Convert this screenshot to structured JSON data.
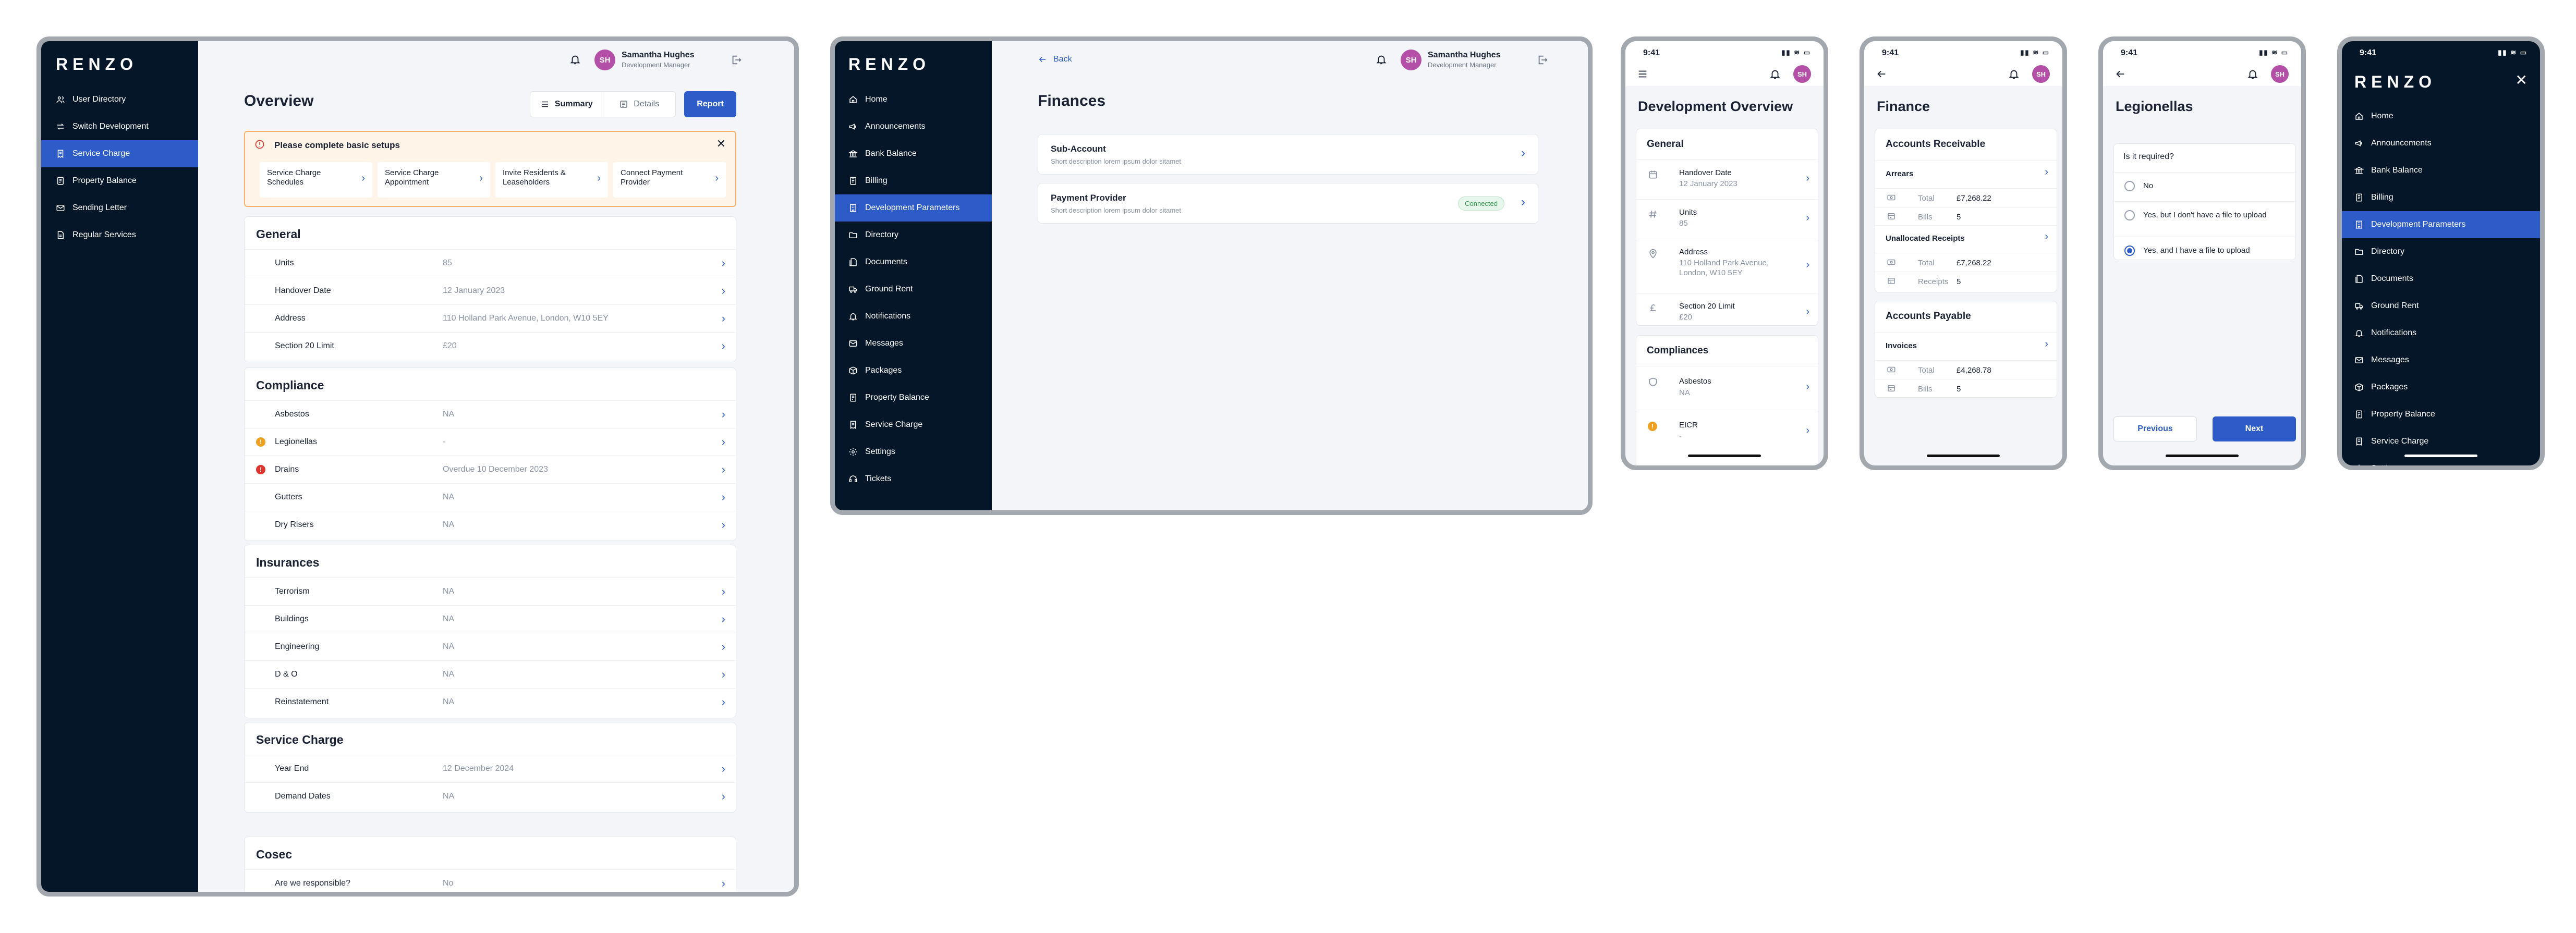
{
  "brand": {
    "logo": "RENZO"
  },
  "user": {
    "name": "Samantha Hughes",
    "role": "Development Manager",
    "initials": "SH"
  },
  "screen1": {
    "nav": [
      {
        "label": "User Directory",
        "icon": "users-icon"
      },
      {
        "label": "Switch Development",
        "icon": "switch-icon"
      },
      {
        "label": "Service Charge",
        "icon": "receipt-icon",
        "active": true
      },
      {
        "label": "Property Balance",
        "icon": "balance-icon"
      },
      {
        "label": "Sending Letter",
        "icon": "mail-icon"
      },
      {
        "label": "Regular Services",
        "icon": "document-icon"
      }
    ],
    "page_title": "Overview",
    "tabs": {
      "summary": "Summary",
      "details": "Details"
    },
    "report_button": "Report",
    "alert": {
      "title": "Please complete basic setups",
      "items": [
        "Service Charge Schedules",
        "Service Charge Appointment",
        "Invite Residents & Leaseholders",
        "Connect Payment Provider"
      ]
    },
    "sections": {
      "general": {
        "title": "General",
        "rows": [
          {
            "label": "Units",
            "value": "85"
          },
          {
            "label": "Handover Date",
            "value": "12 January 2023"
          },
          {
            "label": "Address",
            "value": "110 Holland Park Avenue, London, W10 5EY"
          },
          {
            "label": "Section 20 Limit",
            "value": "£20"
          }
        ]
      },
      "compliance": {
        "title": "Compliance",
        "rows": [
          {
            "label": "Asbestos",
            "value": "NA",
            "status": ""
          },
          {
            "label": "Legionellas",
            "value": "-",
            "status": "warning"
          },
          {
            "label": "Drains",
            "value": "Overdue 10 December 2023",
            "status": "error"
          },
          {
            "label": "Gutters",
            "value": "NA",
            "status": ""
          },
          {
            "label": "Dry Risers",
            "value": "NA",
            "status": ""
          }
        ]
      },
      "insurances": {
        "title": "Insurances",
        "rows": [
          {
            "label": "Terrorism",
            "value": "NA"
          },
          {
            "label": "Buildings",
            "value": "NA"
          },
          {
            "label": "Engineering",
            "value": "NA"
          },
          {
            "label": "D & O",
            "value": "NA"
          },
          {
            "label": "Reinstatement",
            "value": "NA"
          }
        ]
      },
      "service_charge": {
        "title": "Service Charge",
        "rows": [
          {
            "label": "Year End",
            "value": "12 December 2024"
          },
          {
            "label": "Demand Dates",
            "value": "NA"
          }
        ]
      },
      "cosec": {
        "title": "Cosec",
        "rows": [
          {
            "label": "Are we responsible?",
            "value": "No"
          }
        ]
      }
    }
  },
  "screen2": {
    "nav": [
      {
        "label": "Home",
        "icon": "home-icon"
      },
      {
        "label": "Announcements",
        "icon": "megaphone-icon"
      },
      {
        "label": "Bank Balance",
        "icon": "bank-icon"
      },
      {
        "label": "Billing",
        "icon": "billing-icon"
      },
      {
        "label": "Development Parameters",
        "icon": "building-icon",
        "active": true
      },
      {
        "label": "Directory",
        "icon": "folder-icon"
      },
      {
        "label": "Documents",
        "icon": "documents-icon"
      },
      {
        "label": "Ground Rent",
        "icon": "truck-icon"
      },
      {
        "label": "Notifications",
        "icon": "bell-icon"
      },
      {
        "label": "Messages",
        "icon": "mail-icon"
      },
      {
        "label": "Packages",
        "icon": "package-icon"
      },
      {
        "label": "Property Balance",
        "icon": "balance-icon"
      },
      {
        "label": "Service Charge",
        "icon": "receipt-icon"
      },
      {
        "label": "Settings",
        "icon": "gear-icon"
      },
      {
        "label": "Tickets",
        "icon": "headset-icon"
      }
    ],
    "back": "Back",
    "page_title": "Finances",
    "items": [
      {
        "title": "Sub-Account",
        "desc": "Short description lorem ipsum dolor sitamet",
        "badge": ""
      },
      {
        "title": "Payment Provider",
        "desc": "Short description lorem ipsum dolor sitamet",
        "badge": "Connected"
      }
    ]
  },
  "phone1": {
    "time": "9:41",
    "title": "Development Overview",
    "general": {
      "title": "General",
      "rows": [
        {
          "label": "Handover Date",
          "value": "12 January 2023"
        },
        {
          "label": "Units",
          "value": "85"
        },
        {
          "label": "Address",
          "value": "110 Holland Park Avenue, London, W10 5EY"
        },
        {
          "label": "Section 20 Limit",
          "value": "£20"
        }
      ]
    },
    "compliances": {
      "title": "Compliances",
      "rows": [
        {
          "label": "Asbestos",
          "value": "NA"
        },
        {
          "label": "EICR",
          "value": "-"
        }
      ]
    }
  },
  "phone2": {
    "time": "9:41",
    "title": "Finance",
    "receivable": {
      "title": "Accounts Receivable",
      "arrears": {
        "label": "Arrears",
        "total_label": "Total",
        "total": "£7,268.22",
        "count_label": "Bills",
        "count": "5"
      },
      "unallocated": {
        "label": "Unallocated Receipts",
        "total_label": "Total",
        "total": "£7,268.22",
        "count_label": "Receipts",
        "count": "5"
      }
    },
    "payable": {
      "title": "Accounts Payable",
      "invoices": {
        "label": "Invoices",
        "total_label": "Total",
        "total": "£4,268.78",
        "count_label": "Bills",
        "count": "5"
      }
    }
  },
  "phone3": {
    "time": "9:41",
    "title": "Legionellas",
    "question": "Is it required?",
    "options": [
      {
        "label": "No",
        "selected": false
      },
      {
        "label": "Yes, but I don't have a file to upload",
        "selected": false
      },
      {
        "label": "Yes, and I have a file to upload",
        "selected": true
      }
    ],
    "previous": "Previous",
    "next": "Next"
  },
  "phone4": {
    "time": "9:41",
    "nav": [
      {
        "label": "Home",
        "icon": "home-icon"
      },
      {
        "label": "Announcements",
        "icon": "megaphone-icon"
      },
      {
        "label": "Bank Balance",
        "icon": "bank-icon"
      },
      {
        "label": "Billing",
        "icon": "billing-icon"
      },
      {
        "label": "Development Parameters",
        "icon": "building-icon",
        "active": true
      },
      {
        "label": "Directory",
        "icon": "folder-icon"
      },
      {
        "label": "Documents",
        "icon": "documents-icon"
      },
      {
        "label": "Ground Rent",
        "icon": "truck-icon"
      },
      {
        "label": "Notifications",
        "icon": "bell-icon"
      },
      {
        "label": "Messages",
        "icon": "mail-icon"
      },
      {
        "label": "Packages",
        "icon": "package-icon"
      },
      {
        "label": "Property Balance",
        "icon": "balance-icon"
      },
      {
        "label": "Service Charge",
        "icon": "receipt-icon"
      },
      {
        "label": "Settings",
        "icon": "gear-icon"
      }
    ]
  },
  "colors": {
    "sidebar": "#051629",
    "accent": "#2d5cc9",
    "warning": "#f0a020",
    "error": "#e0342f",
    "alert_bg": "#fff4e8",
    "success": "#2e9a4e"
  }
}
